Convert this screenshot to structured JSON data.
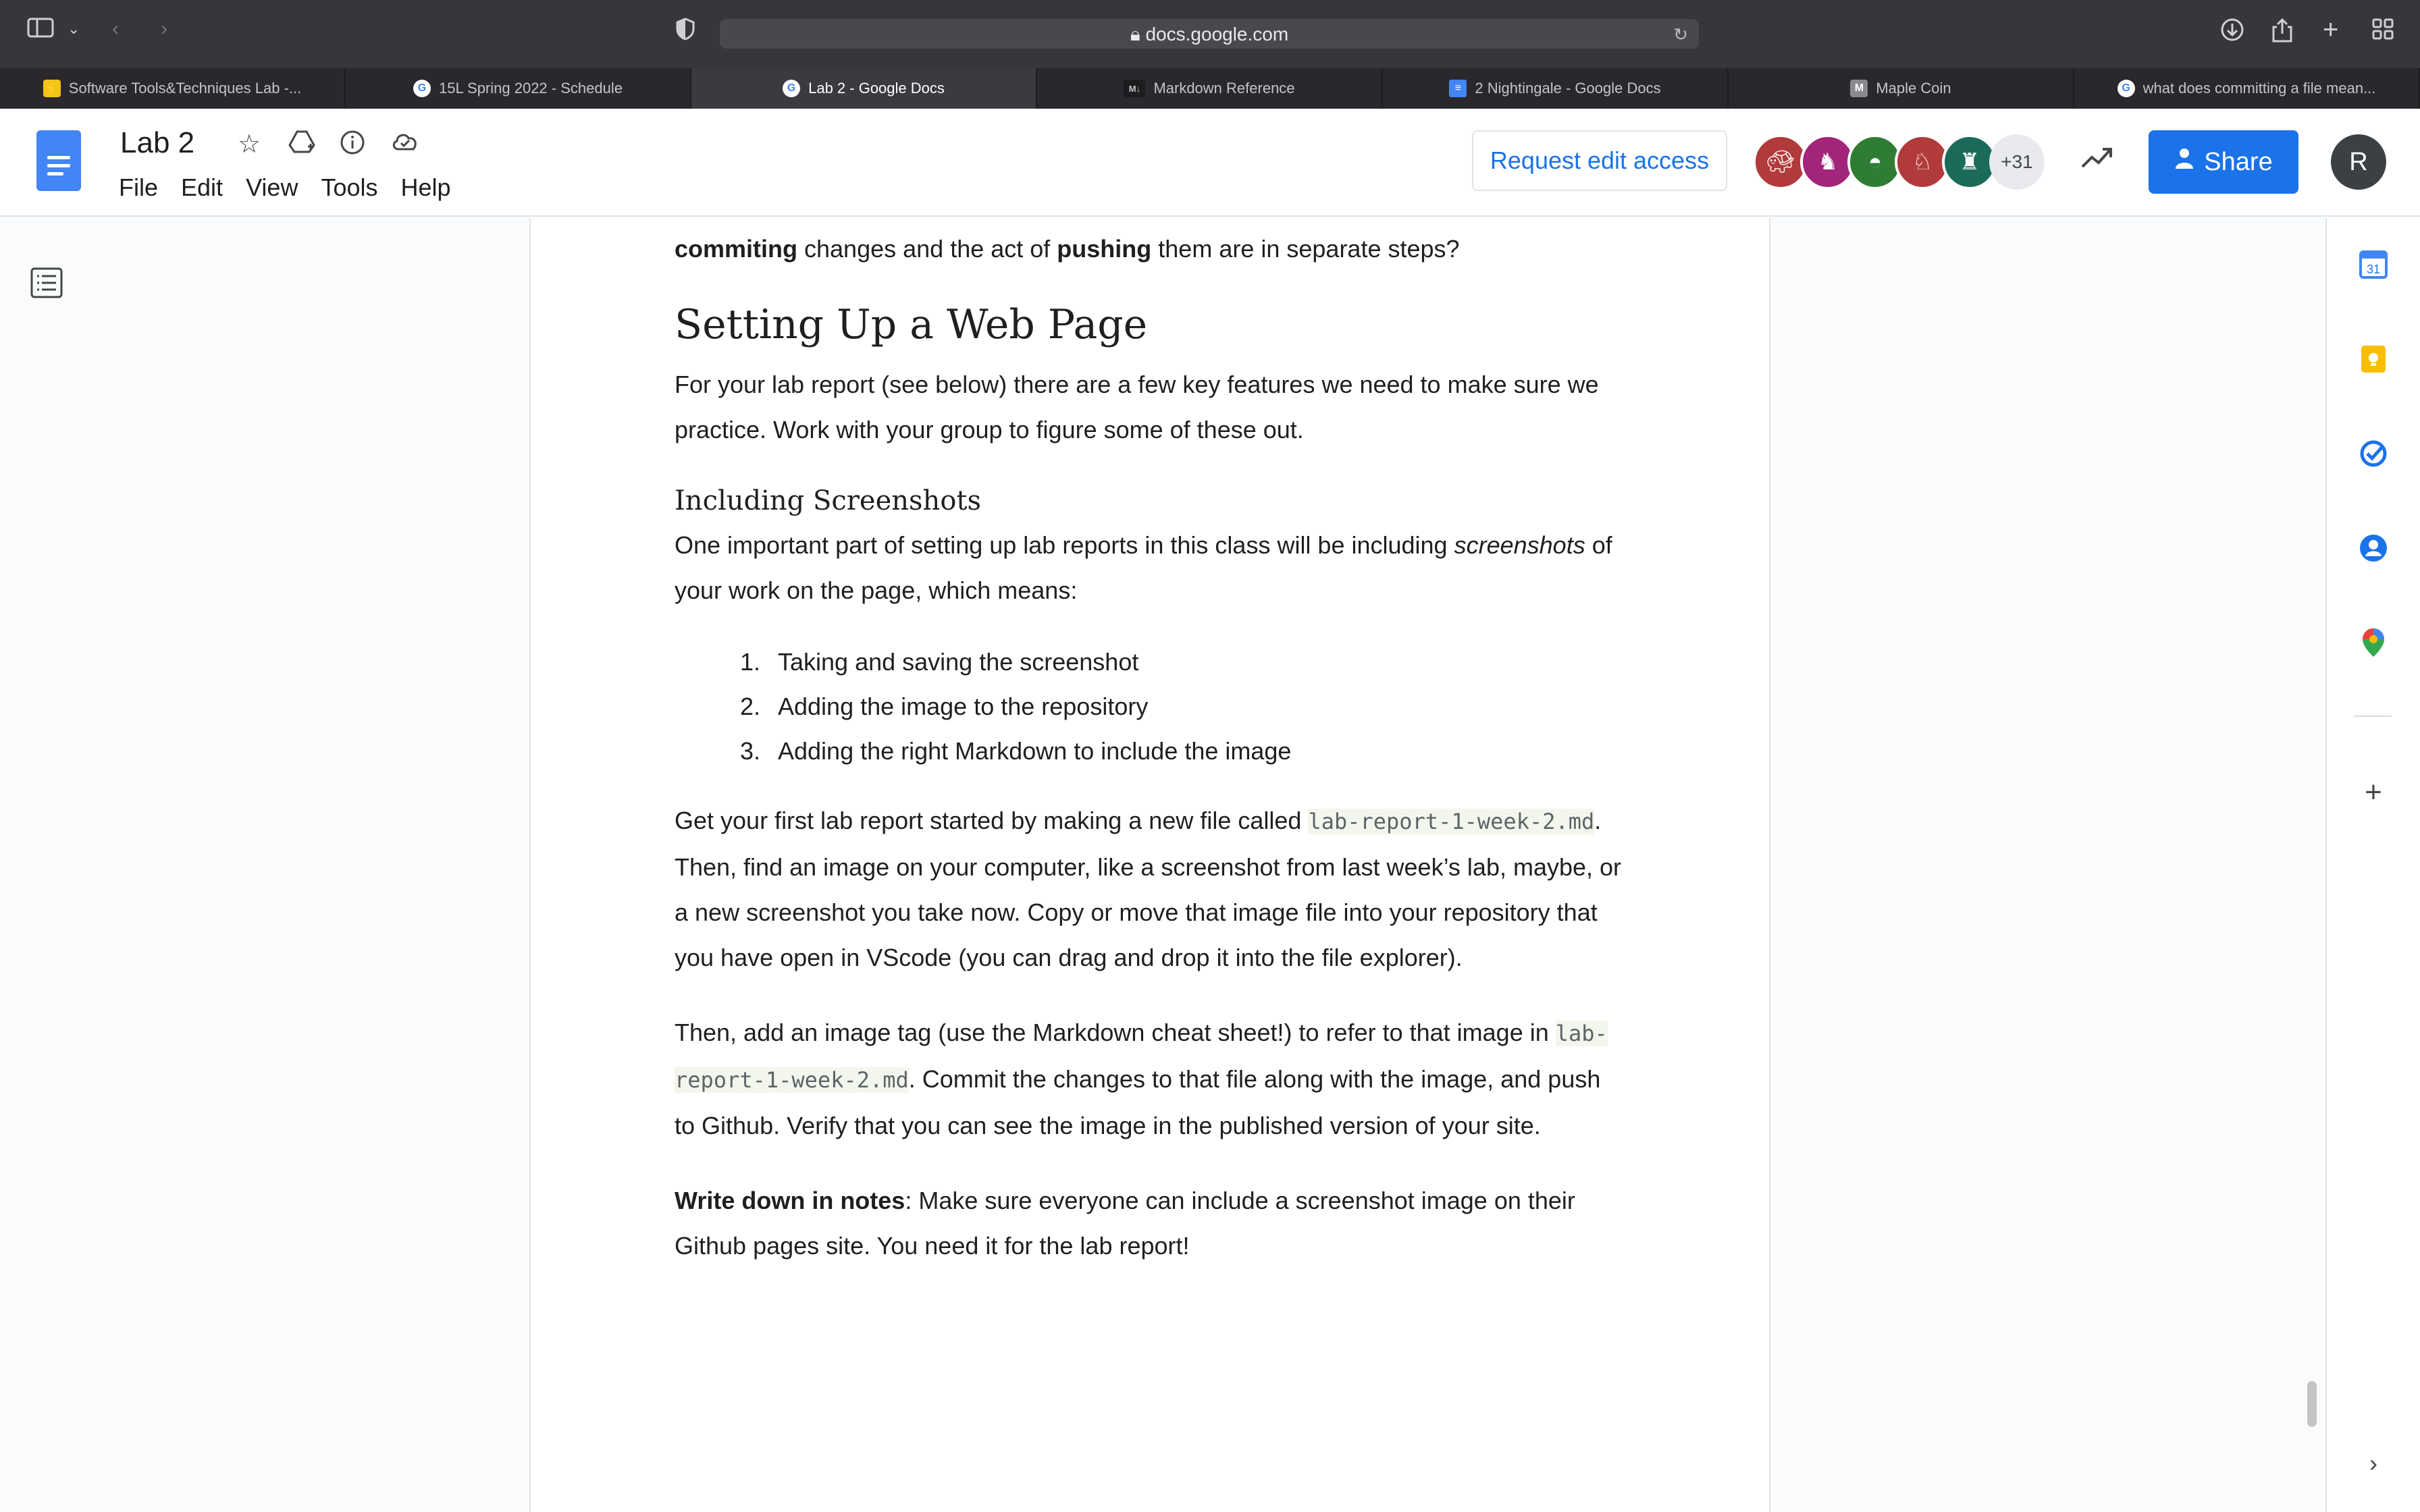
{
  "browser": {
    "url": "docs.google.com",
    "tabs": [
      {
        "title": "Software Tools&Techniques Lab -...",
        "favicon": "bolt",
        "active": false
      },
      {
        "title": "15L Spring 2022 - Schedule",
        "favicon": "google",
        "active": false
      },
      {
        "title": "Lab 2 - Google Docs",
        "favicon": "google",
        "active": true
      },
      {
        "title": "Markdown Reference",
        "favicon": "markdown",
        "active": false
      },
      {
        "title": "2 Nightingale - Google Docs",
        "favicon": "docs",
        "active": false
      },
      {
        "title": "Maple Coin",
        "favicon": "M",
        "active": false
      },
      {
        "title": "what does committing a file mean...",
        "favicon": "google",
        "active": false
      }
    ]
  },
  "doc": {
    "title": "Lab 2",
    "menus": [
      "File",
      "Edit",
      "View",
      "Tools",
      "Help"
    ],
    "request_access_label": "Request edit access",
    "share_label": "Share",
    "collaborators_more": "+31",
    "profile_initial": "R",
    "colors": {
      "accent": "#1a73e8",
      "doc_blue": "#4285f4"
    }
  },
  "content": {
    "intro_bold1": "commiting",
    "intro_mid": " changes and the act of ",
    "intro_bold2": "pushing",
    "intro_end": " them are in separate steps?",
    "h1": "Setting Up a Web Page",
    "p1": "For your lab report (see below) there are a few key features we need to make sure we practice. Work with your group to figure some of these out.",
    "h2": "Including Screenshots",
    "p2_start": "One important part of setting up lab reports in this class will be including ",
    "p2_italic": "screenshots",
    "p2_end": " of your work on the page, which means:",
    "list": [
      {
        "num": "1.",
        "text": "Taking and saving the screenshot"
      },
      {
        "num": "2.",
        "text": "Adding the image to the repository"
      },
      {
        "num": "3.",
        "text": "Adding the right Markdown to include the image"
      }
    ],
    "p3_start": "Get your first lab report started by making a new file called ",
    "filename": "lab-report-1-week-2.md",
    "p3_end": ". Then, find an image on your computer, like a screenshot from last week’s lab, maybe, or a new screenshot you take now. Copy or move that image file into your repository that you have open in VScode (you can drag and drop it into the file explorer).",
    "p4_start": "Then, add an image tag (use the Markdown cheat sheet!) to refer to that image in ",
    "p4_end": ". Commit the changes to that file along with the image, and push to Github. Verify that you can see the image in the published version of your site.",
    "p5_bold": "Write down in notes",
    "p5_end": ": Make sure everyone can include a screenshot image on their Github pages site. You need it for the lab report!"
  }
}
